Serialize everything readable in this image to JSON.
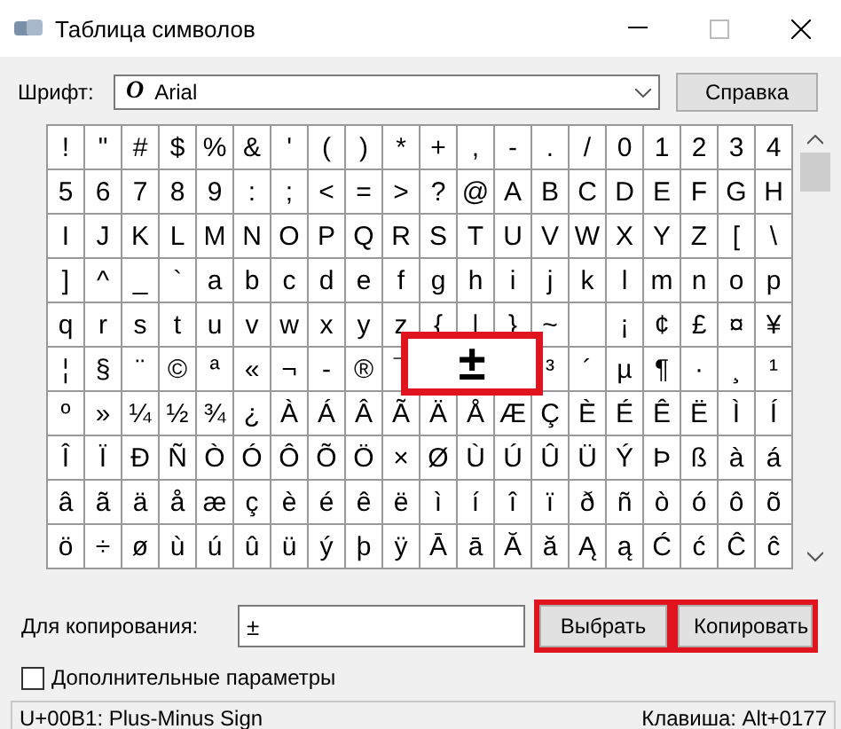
{
  "window": {
    "title": "Таблица символов"
  },
  "font": {
    "label": "Шрифт:",
    "value": "Arial",
    "icon": "O"
  },
  "help_button": {
    "label": "Справка"
  },
  "grid": {
    "rows": [
      [
        "!",
        "\"",
        "#",
        "$",
        "%",
        "&",
        "'",
        "(",
        ")",
        "*",
        "+",
        ",",
        "-",
        ".",
        "/",
        "0",
        "1",
        "2",
        "3",
        "4"
      ],
      [
        "5",
        "6",
        "7",
        "8",
        "9",
        ":",
        ";",
        "<",
        "=",
        ">",
        "?",
        "@",
        "A",
        "B",
        "C",
        "D",
        "E",
        "F",
        "G",
        "H"
      ],
      [
        "I",
        "J",
        "K",
        "L",
        "M",
        "N",
        "O",
        "P",
        "Q",
        "R",
        "S",
        "T",
        "U",
        "V",
        "W",
        "X",
        "Y",
        "Z",
        "[",
        "\\"
      ],
      [
        "]",
        "^",
        "_",
        "`",
        "a",
        "b",
        "c",
        "d",
        "e",
        "f",
        "g",
        "h",
        "i",
        "j",
        "k",
        "l",
        "m",
        "n",
        "o",
        "p"
      ],
      [
        "q",
        "r",
        "s",
        "t",
        "u",
        "v",
        "w",
        "x",
        "y",
        "z",
        "{",
        "|",
        "}",
        "~",
        null,
        "¡",
        "¢",
        "£",
        "¤",
        "¥"
      ],
      [
        "¦",
        "§",
        "¨",
        "©",
        "ª",
        "«",
        "¬",
        "-",
        "®",
        "¯",
        null,
        null,
        null,
        "³",
        "´",
        "µ",
        "¶",
        "·",
        "¸",
        "¹"
      ],
      [
        "º",
        "»",
        "¼",
        "½",
        "¾",
        "¿",
        "À",
        "Á",
        "Â",
        "Ã",
        "Ä",
        "Å",
        "Æ",
        "Ç",
        "È",
        "É",
        "Ê",
        "Ë",
        "Ì",
        "Í"
      ],
      [
        "Î",
        "Ï",
        "Ð",
        "Ñ",
        "Ò",
        "Ó",
        "Ô",
        "Õ",
        "Ö",
        "×",
        "Ø",
        "Ù",
        "Ú",
        "Û",
        "Ü",
        "Ý",
        "Þ",
        "ß",
        "à",
        "á"
      ],
      [
        "â",
        "ã",
        "ä",
        "å",
        "æ",
        "ç",
        "è",
        "é",
        "ê",
        "ë",
        "ì",
        "í",
        "î",
        "ï",
        "ð",
        "ñ",
        "ò",
        "ó",
        "ô",
        "õ"
      ],
      [
        "ö",
        "÷",
        "ø",
        "ù",
        "ú",
        "û",
        "ü",
        "ý",
        "þ",
        "ÿ",
        "Ā",
        "ā",
        "Ă",
        "ă",
        "Ą",
        "ą",
        "Ć",
        "ć",
        "Ĉ",
        "ĉ"
      ]
    ],
    "magnified": {
      "char": "±",
      "highlighted": true
    }
  },
  "copy": {
    "label": "Для копирования:",
    "value": "±"
  },
  "buttons": [
    {
      "label": "Выбрать",
      "highlighted": true
    },
    {
      "label": "Копировать",
      "highlighted": true
    }
  ],
  "advanced": {
    "label": "Дополнительные параметры",
    "checked": false
  },
  "status_bar": {
    "left": "U+00B1: Plus-Minus Sign",
    "right": "Клавиша: Alt+0177"
  }
}
